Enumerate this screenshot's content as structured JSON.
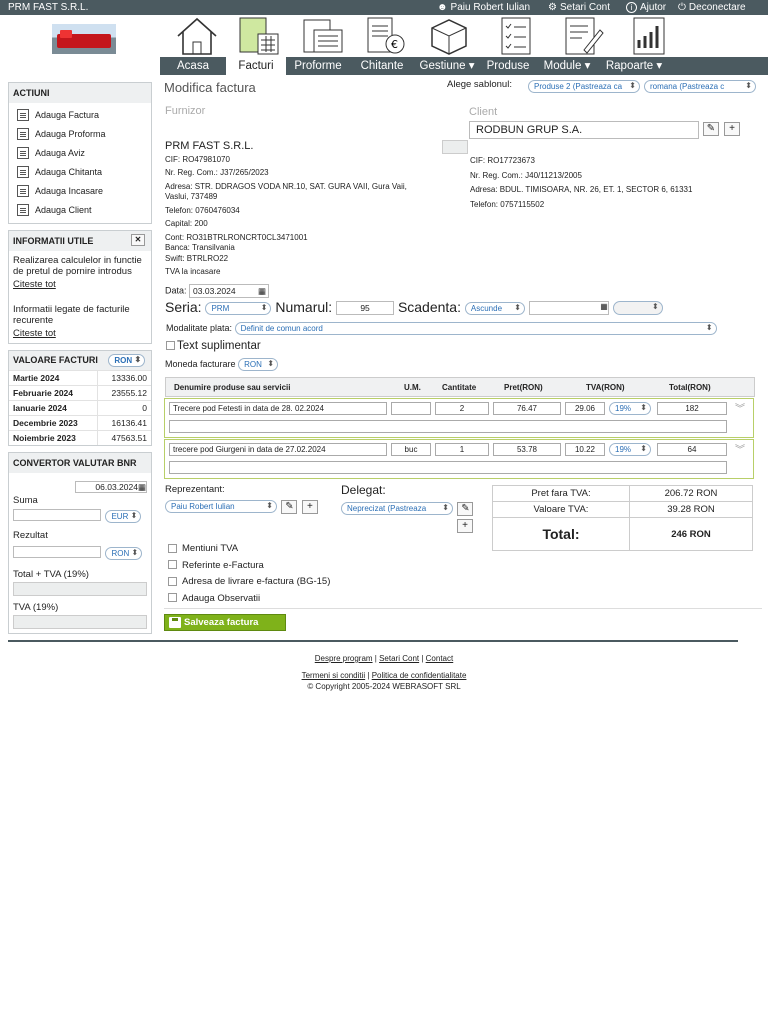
{
  "topbar": {
    "company": "PRM FAST S.R.L.",
    "user": "Paiu Robert Iulian",
    "settings": "Setari Cont",
    "help": "Ajutor",
    "logout": "Deconectare"
  },
  "nav": {
    "tabs": [
      "Acasa",
      "Facturi",
      "Proforme",
      "Chitante",
      "Gestiune ▾",
      "Produse",
      "Module ▾",
      "Rapoarte ▾"
    ]
  },
  "sidebar": {
    "actions_title": "ACTIUNI",
    "actions": [
      "Adauga Factura",
      "Adauga Proforma",
      "Adauga Aviz",
      "Adauga Chitanta",
      "Adauga Incasare",
      "Adauga Client"
    ],
    "info_title": "INFORMATII UTILE",
    "info_close": "✕",
    "info_items": [
      {
        "text": "Realizarea calculelor in functie de pretul de pornire introdus",
        "link": "Citeste tot"
      },
      {
        "text": "Informatii legate de facturile recurente",
        "link": "Citeste tot"
      }
    ],
    "invoice_values_title": "VALOARE FACTURI",
    "invoice_values_currency": "RON",
    "invoice_values": [
      {
        "month": "Martie 2024",
        "value": "13336.00"
      },
      {
        "month": "Februarie 2024",
        "value": "23555.12"
      },
      {
        "month": "Ianuarie 2024",
        "value": "0"
      },
      {
        "month": "Decembrie 2023",
        "value": "16136.41"
      },
      {
        "month": "Noiembrie 2023",
        "value": "47563.51"
      }
    ],
    "converter_title": "CONVERTOR VALUTAR BNR",
    "converter_date": "06.03.2024",
    "sum_label": "Suma",
    "sum_currency": "EUR",
    "result_label": "Rezultat",
    "result_currency": "RON",
    "total_tva_label": "Total + TVA (19%)",
    "tva_label": "TVA (19%)"
  },
  "main": {
    "title": "Modifica factura",
    "template_label": "Alege sablonul:",
    "template_1": "Produse 2 (Pastreaza ca",
    "template_2": "romana (Pastreaza c",
    "supplier_heading": "Furnizor",
    "client_heading": "Client",
    "client_name": "RODBUN GRUP S.A.",
    "supplier": {
      "name": "PRM FAST S.R.L.",
      "cif": "CIF: RO47981070",
      "reg": "Nr. Reg. Com.: J37/265/2023",
      "address": "Adresa: STR. DDRAGOS VODA NR.10, SAT. GURA VAII, Gura Vaii, Vaslui, 737489",
      "phone": "Telefon: 0760476034",
      "capital": "Capital: 200",
      "account": "Cont: RO31BTRLRONCRT0CL3471001",
      "bank": "Banca: Transilvania",
      "swift": "Swift: BTRLRO22",
      "tva": "TVA la incasare"
    },
    "client": {
      "cif": "CIF: RO17723673",
      "reg": "Nr. Reg. Com.: J40/11213/2005",
      "address": "Adresa: BDUL. TIMISOARA, NR. 26, ET. 1, SECTOR 6, 61331",
      "phone": "Telefon: 0757115502"
    },
    "date_label": "Data:",
    "date_value": "03.03.2024",
    "series_label": "Seria:",
    "series_value": "PRM",
    "number_label": "Numarul:",
    "number_value": "95",
    "due_label": "Scadenta:",
    "due_value": "Ascunde",
    "payment_label": "Modalitate plata:",
    "payment_value": "Definit de comun acord",
    "extra_text_label": "Text suplimentar",
    "currency_label": "Moneda facturare",
    "currency_value": "RON",
    "table_headers": [
      "Denumire produse sau servicii",
      "U.M.",
      "Cantitate",
      "Pret(RON)",
      "TVA(RON)",
      "Total(RON)"
    ],
    "items": [
      {
        "name": "Trecere pod Fetesti in data de 28. 02.2024",
        "um": "",
        "qty": "2",
        "price": "76.47",
        "tva": "29.06",
        "rate": "19%",
        "total": "182"
      },
      {
        "name": "trecere pod Giurgeni in data de 27.02.2024",
        "um": "buc",
        "qty": "1",
        "price": "53.78",
        "tva": "10.22",
        "rate": "19%",
        "total": "64"
      }
    ],
    "rep_label": "Reprezentant:",
    "rep_value": "Paiu Robert Iulian",
    "delegate_label": "Delegat:",
    "delegate_value": "Neprecizat (Pastreaza",
    "totals": {
      "net_label": "Pret fara TVA:",
      "net_value": "206.72 RON",
      "tva_label": "Valoare TVA:",
      "tva_value": "39.28 RON",
      "total_label": "Total:",
      "total_value": "246 RON"
    },
    "options": [
      "Mentiuni TVA",
      "Referinte e-Factura",
      "Adresa de livrare e-factura (BG-15)",
      "Adauga Observatii"
    ],
    "save_label": "Salveaza factura"
  },
  "footer": {
    "links1": [
      "Despre program",
      "Setari Cont",
      "Contact"
    ],
    "links2": [
      "Termeni si conditii",
      "Politica de confidentialitate"
    ],
    "copyright": "© Copyright 2005-2024 WEBRASOFT SRL"
  },
  "colors": {
    "bar": "#4b5a60",
    "accent_green": "#7fb21a",
    "select_blue": "#2b6fb6"
  }
}
